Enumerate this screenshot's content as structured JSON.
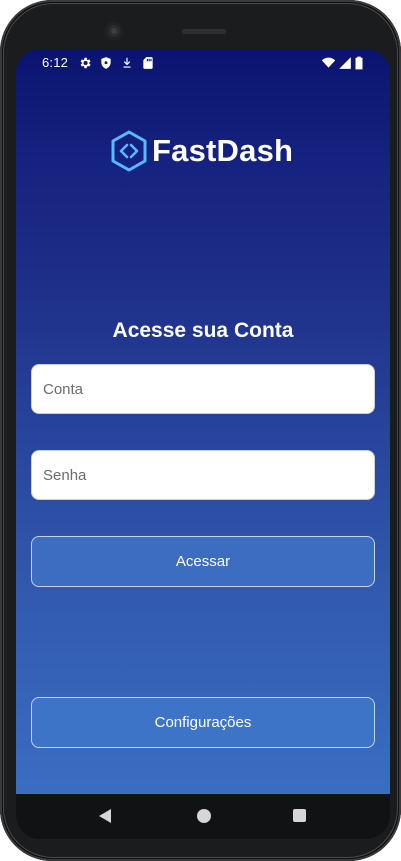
{
  "status_bar": {
    "time": "6:12",
    "icons": [
      "gear-icon",
      "shield-icon",
      "download-icon",
      "sd-card-icon",
      "wifi-icon",
      "signal-icon",
      "battery-icon"
    ]
  },
  "brand": {
    "name": "FastDash",
    "icon": "hexagon-code-icon",
    "accent_color": "#5ab8ff"
  },
  "login": {
    "title": "Acesse sua Conta",
    "account_placeholder": "Conta",
    "account_value": "",
    "password_placeholder": "Senha",
    "password_value": "",
    "submit_label": "Acessar"
  },
  "footer": {
    "settings_label": "Configurações"
  },
  "navigation_bar": {
    "icons": [
      "back-icon",
      "home-icon",
      "recents-icon"
    ]
  },
  "colors": {
    "background_top": "#0a1470",
    "background_bottom": "#3a6dc2",
    "button": "#3c6dc1"
  }
}
